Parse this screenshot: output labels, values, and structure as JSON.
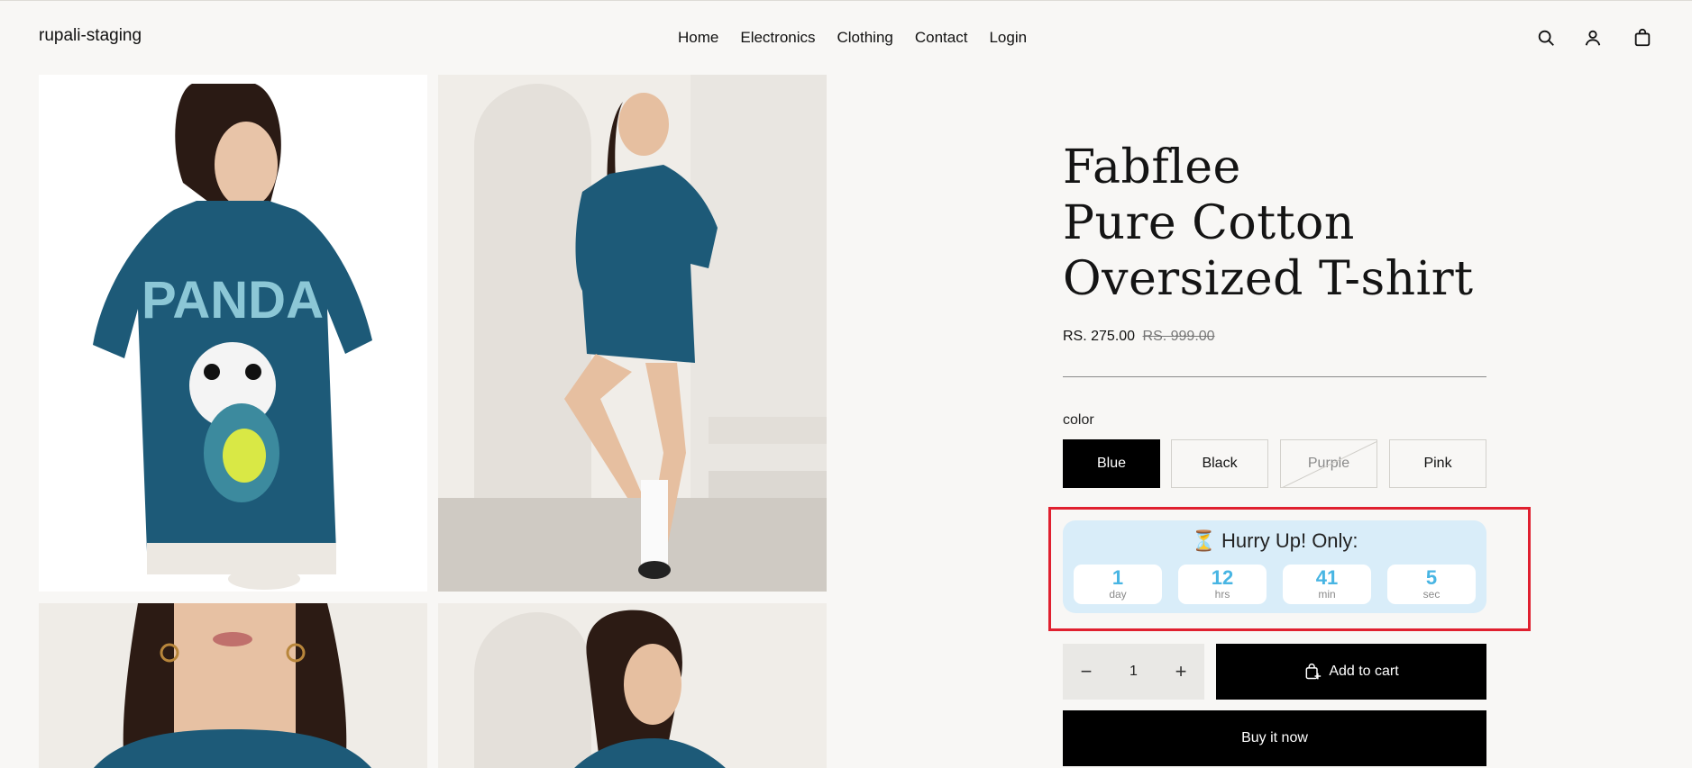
{
  "header": {
    "brand": "rupali-staging",
    "nav": [
      {
        "label": "Home"
      },
      {
        "label": "Electronics"
      },
      {
        "label": "Clothing"
      },
      {
        "label": "Contact"
      },
      {
        "label": "Login"
      }
    ],
    "icons": [
      "search-icon",
      "account-icon",
      "cart-bag-icon"
    ]
  },
  "gallery": {
    "images": [
      {
        "name": "product-image-back-view"
      },
      {
        "name": "product-image-side-pose"
      },
      {
        "name": "product-image-front-closeup"
      },
      {
        "name": "product-image-portrait"
      }
    ]
  },
  "product": {
    "title_lines": [
      "Fabflee",
      "Pure Cotton",
      "Oversized T-shirt"
    ],
    "price": "RS. 275.00",
    "compare_price": "RS. 999.00",
    "option_label": "color",
    "colors": [
      {
        "label": "Blue",
        "state": "selected"
      },
      {
        "label": "Black",
        "state": "available"
      },
      {
        "label": "Purple",
        "state": "unavailable"
      },
      {
        "label": "Pink",
        "state": "available"
      }
    ]
  },
  "countdown": {
    "title": "⏳ Hurry Up! Only:",
    "units": [
      {
        "value": "1",
        "label": "day"
      },
      {
        "value": "12",
        "label": "hrs"
      },
      {
        "value": "41",
        "label": "min"
      },
      {
        "value": "5",
        "label": "sec"
      }
    ],
    "accent_color": "#48b5e3",
    "highlight_color": "#e0202f"
  },
  "cart": {
    "decrease": "−",
    "quantity": "1",
    "increase": "+",
    "add_to_cart": "Add to cart",
    "buy_now": "Buy it now"
  }
}
